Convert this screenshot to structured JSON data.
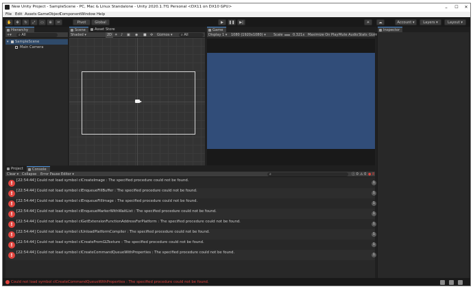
{
  "window": {
    "title": "New Unity Project - SampleScene - PC, Mac & Linux Standalone - Unity 2020.1.7f1 Personal <DX11 on DX10 GPU>",
    "minimize": "–",
    "maximize": "☐",
    "close": "✕"
  },
  "menu": [
    "File",
    "Edit",
    "Assets",
    "GameObject",
    "Component",
    "Window",
    "Help"
  ],
  "toolbar": {
    "pivot": "Pivot",
    "global": "Global",
    "account": "Account",
    "layers": "Layers",
    "layout": "Layout"
  },
  "hierarchy": {
    "tab": "Hierarchy",
    "search_placeholder": "All",
    "scene": "SampleScene",
    "items": [
      "Main Camera"
    ]
  },
  "scene": {
    "tabs": [
      "Scene",
      "Asset Store"
    ],
    "shading": "Shaded",
    "mode_2d": "2D",
    "gizmos": "Gizmos",
    "search_placeholder": "All"
  },
  "game": {
    "tab": "Game",
    "display": "Display 1",
    "resolution": "1080 (1920x1080)",
    "scale_label": "Scale",
    "scale_value": "0.321x",
    "maximize_on_play": "Maximize On Play",
    "mute_audio": "Mute Audio",
    "stats": "Stats",
    "gizmos": "Gizmos",
    "background_color": "#314d79"
  },
  "inspector": {
    "tab": "Inspector"
  },
  "bottom": {
    "tabs": [
      "Project",
      "Console"
    ],
    "clear": "Clear",
    "collapse": "Collapse",
    "error_pause": "Error Pause",
    "editor": "Editor",
    "counts": {
      "log": "0",
      "warn": "0",
      "error": "8"
    }
  },
  "console": {
    "rows": [
      {
        "text": "[22:54:44] Could not load symbol clCreateImage : The specified procedure could not be found.",
        "count": "1"
      },
      {
        "text": "[22:54:44] Could not load symbol clEnqueueFillBuffer : The specified procedure could not be found.",
        "count": "1"
      },
      {
        "text": "[22:54:44] Could not load symbol clEnqueueFillImage : The specified procedure could not be found.",
        "count": "1"
      },
      {
        "text": "[22:54:44] Could not load symbol clEnqueueMarkerWithWaitList : The specified procedure could not be found.",
        "count": "1"
      },
      {
        "text": "[22:54:44] Could not load symbol clGetExtensionFunctionAddressForPlatform : The specified procedure could not be found.",
        "count": "1"
      },
      {
        "text": "[22:54:44] Could not load symbol clUnloadPlatformCompiler : The specified procedure could not be found.",
        "count": "1"
      },
      {
        "text": "[22:54:44] Could not load symbol clCreateFromGLTexture : The specified procedure could not be found.",
        "count": "1"
      },
      {
        "text": "[22:54:44] Could not load symbol clCreateCommandQueueWithProperties : The specified procedure could not be found.",
        "count": "1"
      }
    ]
  },
  "status": {
    "message": "Could not load symbol clCreateCommandQueueWithProperties : The specified procedure could not be found.",
    "error_color": "#e0443e"
  }
}
